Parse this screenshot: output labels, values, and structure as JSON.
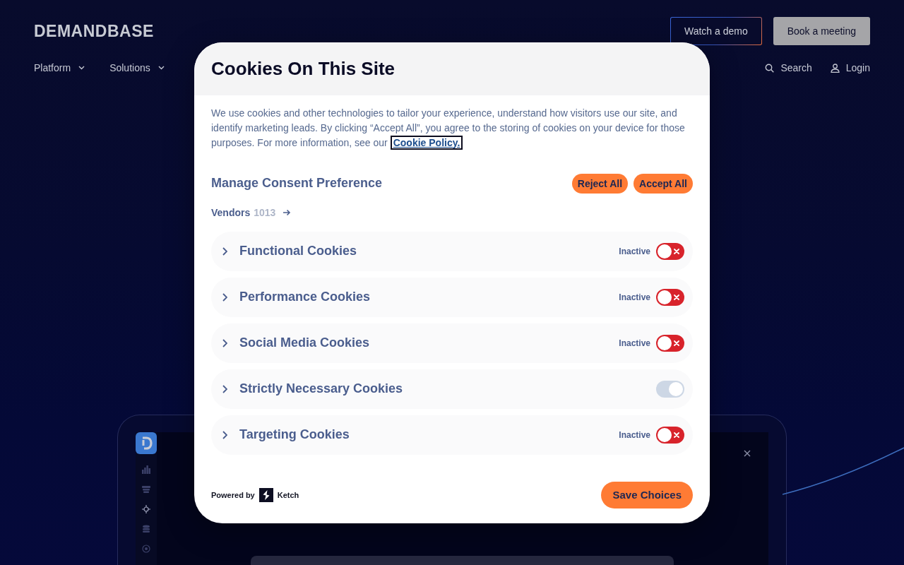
{
  "header": {
    "logo": "DEMANDBASE",
    "buttons": [
      {
        "label": "Watch a demo",
        "kind": "outline"
      },
      {
        "label": "Book a meeting",
        "kind": "filled"
      }
    ],
    "nav": [
      {
        "label": "Platform"
      },
      {
        "label": "Solutions"
      }
    ],
    "utility": [
      {
        "label": "Search",
        "kind": "search"
      },
      {
        "label": "Login",
        "kind": "user"
      }
    ]
  },
  "dialog": {
    "title": "Cookies On This Site",
    "intro": "We use cookies and other technologies to tailor your experience, understand how visitors use our site, and identify marketing leads. By clicking “Accept All”, you agree to the storing of cookies on your device for those purposes. For more information, see our",
    "link": {
      "label": "Cookie Policy.",
      "focused": true
    },
    "section_title": "Manage Consent Preference",
    "actions": [
      "Reject All",
      "Accept All"
    ],
    "vendors": {
      "label": "Vendors",
      "count": "1013"
    },
    "categories": [
      {
        "title": "Functional Cookies",
        "status": "Inactive",
        "on": false,
        "disabled": false,
        "expanded": false
      },
      {
        "title": "Performance Cookies",
        "status": "Inactive",
        "on": false,
        "disabled": false,
        "expanded": false
      },
      {
        "title": "Social Media Cookies",
        "status": "Inactive",
        "on": false,
        "disabled": false,
        "expanded": false
      },
      {
        "title": "Strictly Necessary Cookies",
        "on": true,
        "disabled": true,
        "expanded": false
      },
      {
        "title": "Targeting Cookies",
        "status": "Inactive",
        "on": false,
        "disabled": false,
        "expanded": false
      }
    ],
    "powered_by": "Powered by",
    "brand": "Ketch",
    "save": "Save Choices"
  }
}
